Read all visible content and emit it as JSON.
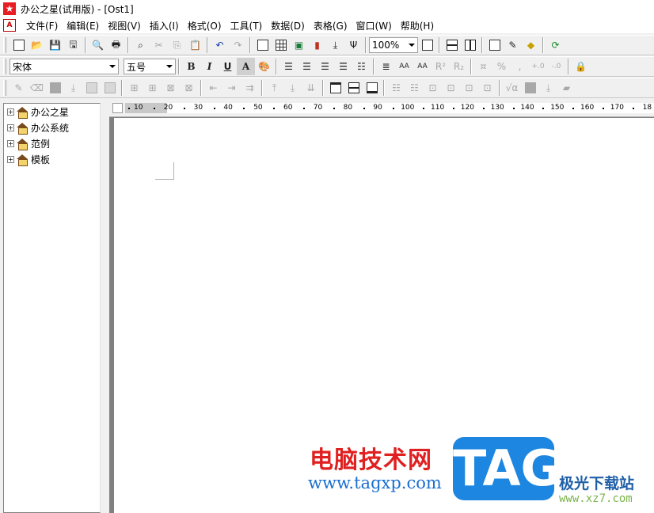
{
  "window": {
    "title": "办公之星(试用版) - [Ost1]"
  },
  "menu": [
    "文件(F)",
    "编辑(E)",
    "视图(V)",
    "插入(I)",
    "格式(O)",
    "工具(T)",
    "数据(D)",
    "表格(G)",
    "窗口(W)",
    "帮助(H)"
  ],
  "toolbar1": {
    "zoom": "100%",
    "text_glyphs": {
      "psi": "Ψ"
    }
  },
  "toolbar2": {
    "font": "宋体",
    "size": "五号",
    "bold": "B",
    "italic": "I",
    "underline": "U",
    "outline": "A",
    "spacing1": "AA",
    "spacing2": "AA",
    "superscript": "R²",
    "subscript": "R₂",
    "percent": "%",
    "comma": ",",
    "dec_inc": "+.0",
    "dec_dec": "-.0"
  },
  "toolbar3": {
    "sqrt": "√α"
  },
  "ruler": {
    "labels": [
      "10",
      "20",
      "30",
      "40",
      "50",
      "60",
      "70",
      "80",
      "90",
      "100",
      "110",
      "120",
      "130",
      "140",
      "150",
      "160",
      "170",
      "18"
    ]
  },
  "tree": [
    "办公之星",
    "办公系统",
    "范例",
    "模板"
  ],
  "watermark": {
    "cn": "电脑技术网",
    "url": "www.tagxp.com",
    "tag": "TAG",
    "site": "极光下载站",
    "site_url": "www.xz7.com"
  },
  "colors": {
    "title_logo": "#e81c23",
    "watermark_red": "#e02020",
    "watermark_blue": "#1d86e0"
  }
}
